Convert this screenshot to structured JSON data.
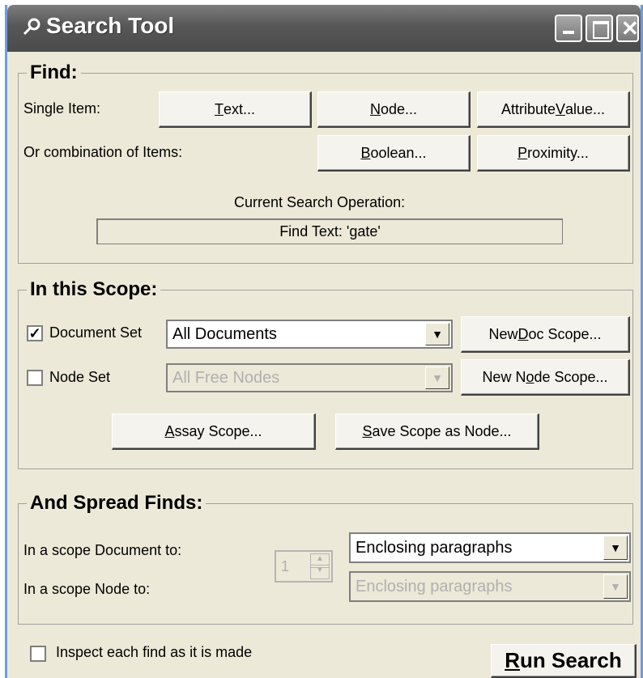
{
  "window": {
    "title": "Search Tool"
  },
  "find": {
    "legend": "Find:",
    "single_item_label": "Single Item:",
    "text_button": {
      "pre": "",
      "key": "T",
      "post": "ext..."
    },
    "node_button": {
      "pre": "",
      "key": "N",
      "post": "ode..."
    },
    "attribute_button": {
      "pre": "Attribute ",
      "key": "V",
      "post": "alue..."
    },
    "combination_label": "Or combination of Items:",
    "boolean_button": {
      "pre": "",
      "key": "B",
      "post": "oolean..."
    },
    "proximity_button": {
      "pre": "",
      "key": "P",
      "post": "roximity..."
    },
    "current_op_label": "Current Search Operation:",
    "current_op_value": "Find Text: 'gate'"
  },
  "scope": {
    "legend": "In this Scope:",
    "document_set": {
      "label": "Document Set",
      "checked": true,
      "value": "All Documents"
    },
    "new_doc_button": {
      "pre": "New ",
      "key": "D",
      "post": "oc Scope..."
    },
    "node_set": {
      "label": "Node Set",
      "checked": false,
      "value": "All Free Nodes"
    },
    "new_node_button": {
      "pre": "New N",
      "key": "o",
      "post": "de Scope..."
    },
    "assay_button": {
      "pre": "",
      "key": "A",
      "post": "ssay Scope..."
    },
    "save_button": {
      "pre": "",
      "key": "S",
      "post": "ave Scope as Node..."
    }
  },
  "spread": {
    "legend": "And Spread Finds:",
    "doc_label": "In a scope Document to:",
    "node_label": "In a scope Node to:",
    "spin_value": "1",
    "doc_value": "Enclosing paragraphs",
    "node_value": "Enclosing paragraphs"
  },
  "footer": {
    "inspect_label": "Inspect each find as it is made",
    "run_button": {
      "pre": "",
      "key": "R",
      "post": "un Search"
    }
  }
}
